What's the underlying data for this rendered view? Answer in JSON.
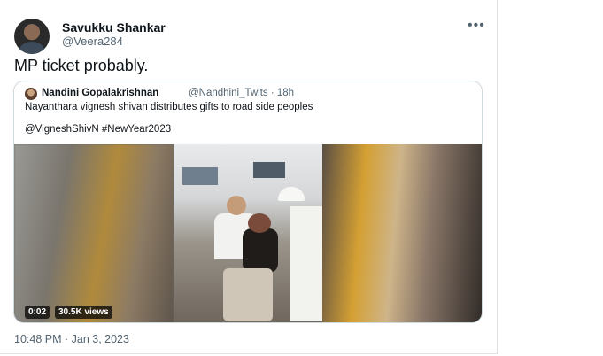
{
  "tweet": {
    "display_name": "Savukku Shankar",
    "handle": "@Veera284",
    "text": "MP ticket probably.",
    "timestamp": "10:48 PM · Jan 3, 2023",
    "more_icon": "more-horizontal-icon"
  },
  "quoted_tweet": {
    "display_name": "Nandini Gopalakrishnan",
    "handle_time": "@Nandhini_Twits · 18h",
    "text": "Nayanthara vignesh shivan distributes gifts to road side peoples",
    "hashtags": "@VigneshShivN #NewYear2023",
    "video": {
      "duration": "0:02",
      "views": "30.5K views"
    }
  },
  "colors": {
    "text_primary": "#0f1419",
    "text_secondary": "#536471",
    "border": "#cfd9de"
  }
}
